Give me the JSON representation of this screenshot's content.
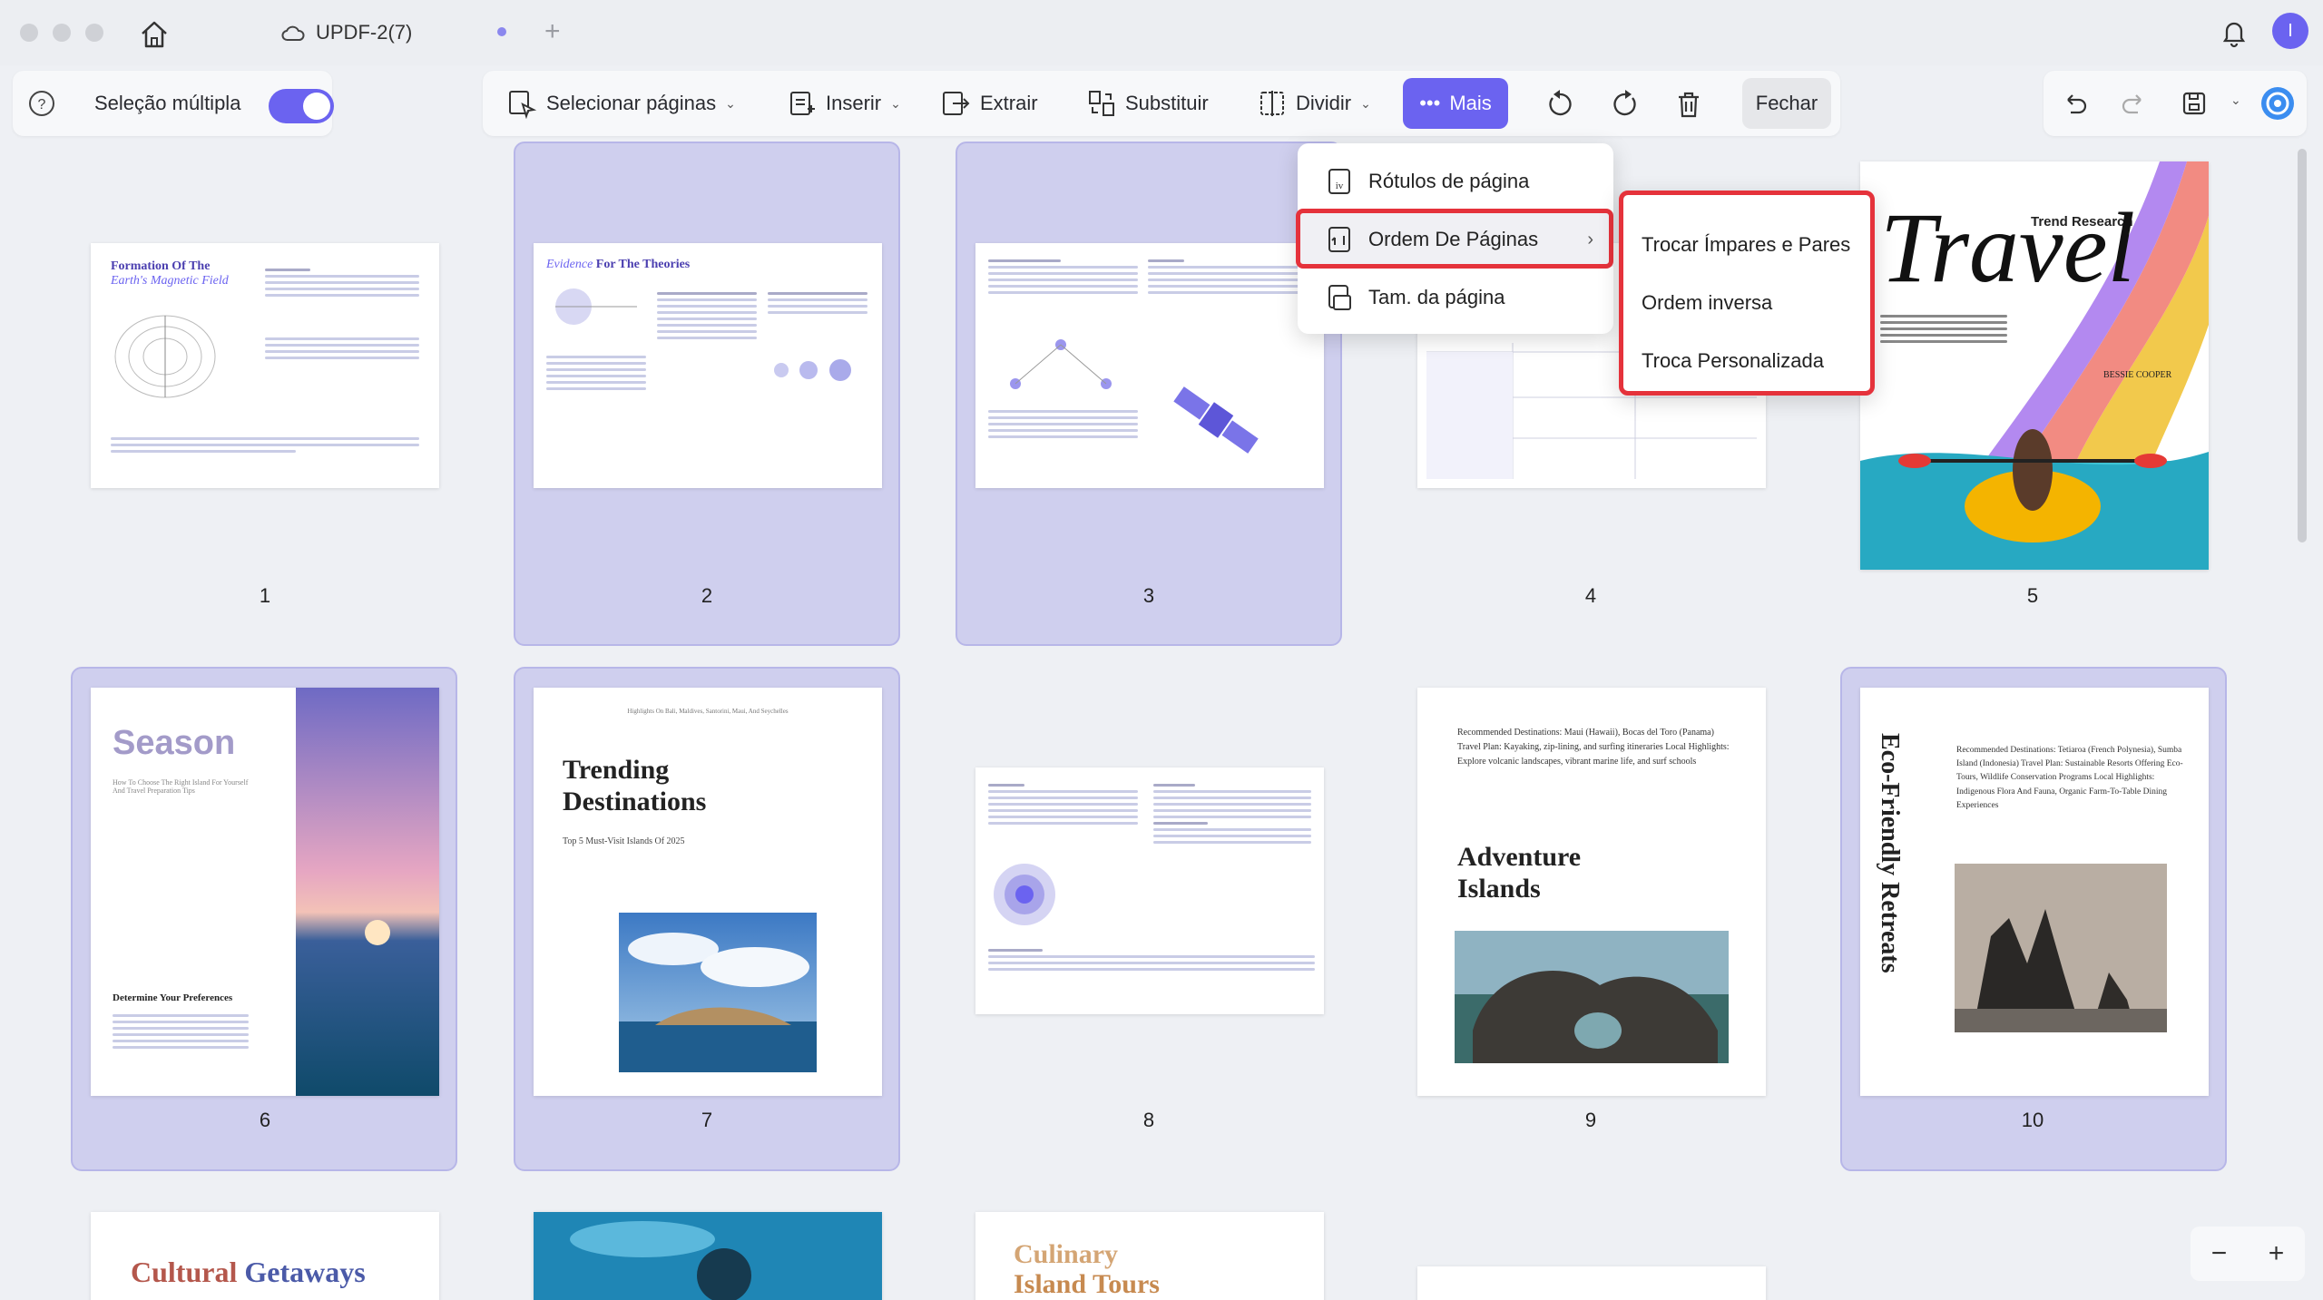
{
  "window": {
    "tab_title": "UPDF-2(7)",
    "tab_new": "+"
  },
  "user": {
    "initial": "I"
  },
  "toolbar": {
    "multi_select_label": "Seleção múltipla",
    "select_pages": "Selecionar páginas",
    "insert": "Inserir",
    "extract": "Extrair",
    "replace": "Substituir",
    "split": "Dividir",
    "more": "Mais",
    "close": "Fechar"
  },
  "menu": {
    "items": [
      "Rótulos de página",
      "Ordem De Páginas",
      "Tam. da página"
    ],
    "submenu": [
      "Trocar Ímpares e Pares",
      "Ordem inversa",
      "Troca Personalizada"
    ]
  },
  "pages": {
    "numbers": [
      "1",
      "2",
      "3",
      "4",
      "5",
      "6",
      "7",
      "8",
      "9",
      "10"
    ],
    "p1_title": "Formation Of The",
    "p1_subtitle": "Earth's Magnetic Field",
    "p2_title_a": "Evidence",
    "p2_title_b": "For The Theories",
    "p5_trend": "Trend Research",
    "p5_title": "Travel",
    "p5_author": "BESSIE COOPER",
    "p6_title": "Season",
    "p6_sub": "How To Choose The Right Island For Yourself And Travel Preparation Tips",
    "p6_h": "Determine Your Preferences",
    "p7_top": "Highlights On Bali, Maldives, Santorini, Maui, And Seychelles",
    "p7_title": "Trending Destinations",
    "p7_sub": "Top 5 Must-Visit Islands Of 2025",
    "p9_text": "Recommended Destinations: Maui (Hawaii), Bocas del Toro (Panama) Travel Plan: Kayaking, zip-lining, and surfing itineraries Local Highlights: Explore volcanic landscapes, vibrant marine life, and surf schools",
    "p9_title": "Adventure Islands",
    "p10_vertical": "Eco-Friendly Retreats",
    "p10_text": "Recommended Destinations: Tetiaroa (French Polynesia), Sumba Island (Indonesia) Travel Plan: Sustainable Resorts Offering Eco-Tours, Wildlife Conservation Programs Local Highlights: Indigenous Flora And Fauna, Organic Farm-To-Table Dining Experiences",
    "p11_a": "Cultural",
    "p11_b": "Getaways",
    "p13_a": "Culinary",
    "p13_b": "Island Tours"
  },
  "zoom": {
    "minus": "−",
    "plus": "+"
  },
  "colors": {
    "accent": "#6b63f0",
    "selected_cell": "#cfcfee",
    "highlight": "#e5323b"
  }
}
